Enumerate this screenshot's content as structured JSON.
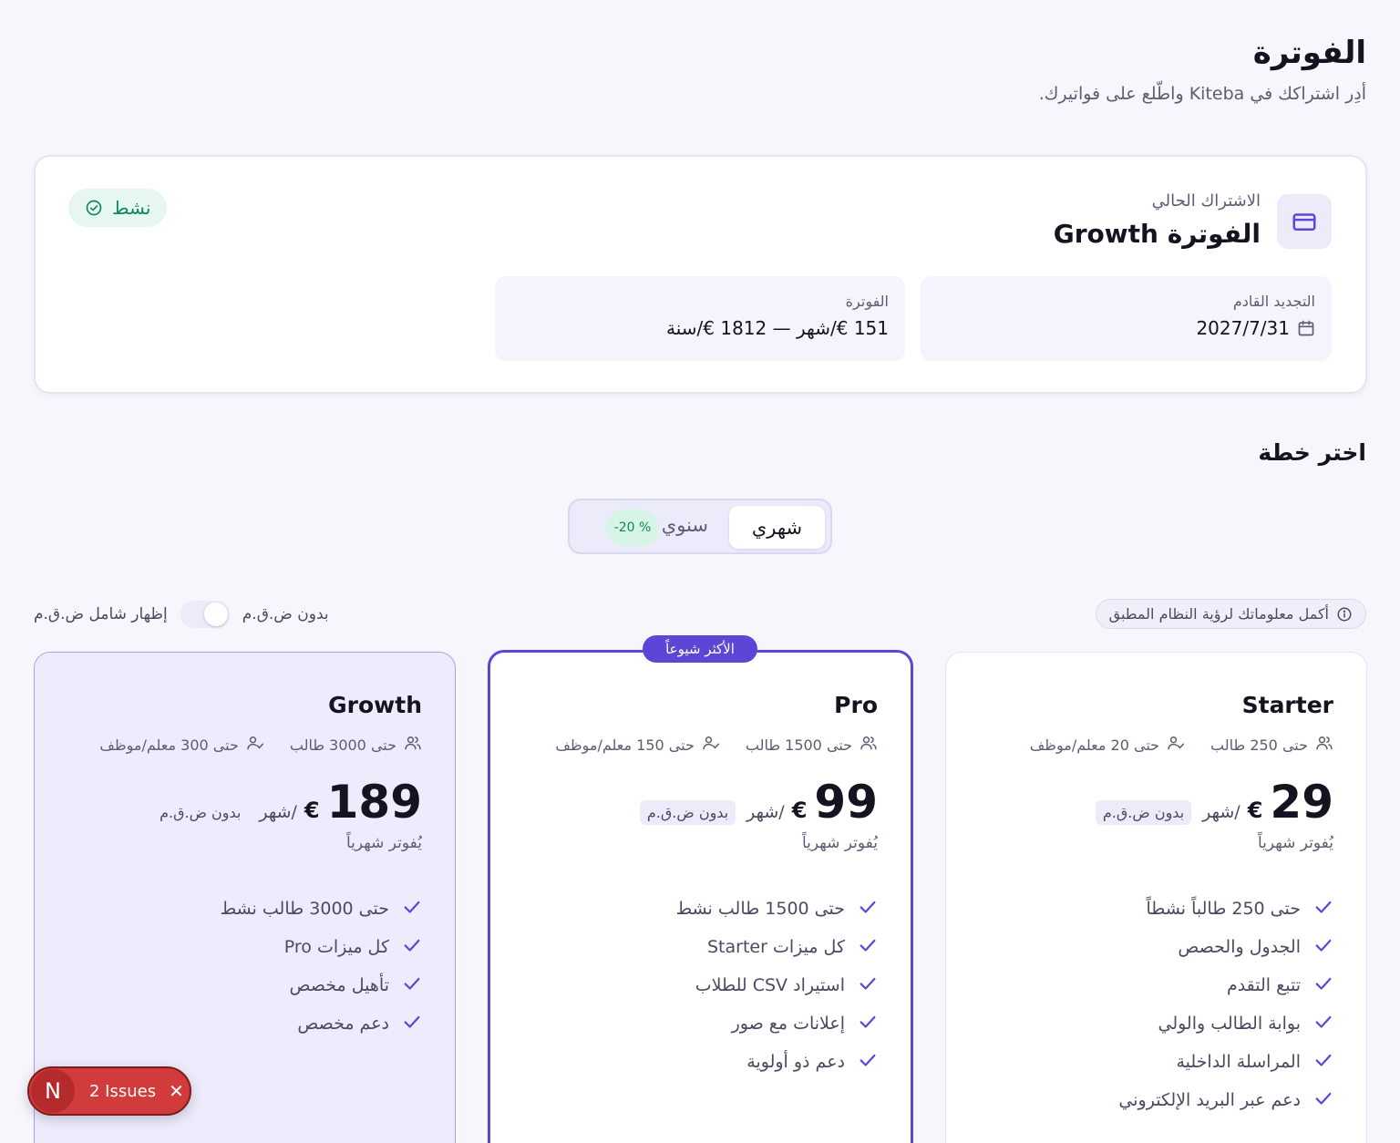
{
  "header": {
    "title": "الفوترة",
    "subtitle": "أدِر اشتراكك في Kiteba واطّلع على فواتيرك."
  },
  "subscription": {
    "caption": "الاشتراك الحالي",
    "plan_name": "الفوترة Growth",
    "status": "نشط",
    "next_renewal_label": "التجديد القادم",
    "next_renewal_value": "2027/7/31",
    "billing_label": "الفوترة",
    "billing_value": "151 €/شهر — 1812 €/سنة"
  },
  "choose_plan": {
    "title": "اختر خطة",
    "monthly_label": "شهري",
    "yearly_label": "سنوي",
    "yearly_discount": "-20 %",
    "info_text": "أكمل معلوماتك لرؤية النظام المطبق",
    "vat_off_label": "بدون ض.ق.م",
    "vat_on_label": "إظهار شامل ض.ق.م",
    "vat_toggle_on": false,
    "popular_badge": "الأكثر شيوعاً"
  },
  "plans": [
    {
      "name": "Starter",
      "students": "حتى 250 طالب",
      "staff": "حتى 20 معلم/موظف",
      "price": "29",
      "currency": "€",
      "per": "/شهر",
      "vat": "بدون ض.ق.م",
      "billing": "يُفوتر شهرياً",
      "features": [
        "حتى 250 طالباً نشطاً",
        "الجدول والحصص",
        "تتبع التقدم",
        "بوابة الطالب والولي",
        "المراسلة الداخلية",
        "دعم عبر البريد الإلكتروني"
      ]
    },
    {
      "name": "Pro",
      "students": "حتى 1500 طالب",
      "staff": "حتى 150 معلم/موظف",
      "price": "99",
      "currency": "€",
      "per": "/شهر",
      "vat": "بدون ض.ق.م",
      "billing": "يُفوتر شهرياً",
      "features": [
        "حتى 1500 طالب نشط",
        "كل ميزات Starter",
        "استيراد CSV للطلاب",
        "إعلانات مع صور",
        "دعم ذو أولوية"
      ]
    },
    {
      "name": "Growth",
      "students": "حتى 3000 طالب",
      "staff": "حتى 300 معلم/موظف",
      "price": "189",
      "currency": "€",
      "per": "/شهر",
      "vat": "بدون ض.ق.م",
      "billing": "يُفوتر شهرياً",
      "features": [
        "حتى 3000 طالب نشط",
        "كل ميزات Pro",
        "تأهيل مخصص",
        "دعم مخصص"
      ]
    }
  ],
  "dev_overlay": {
    "logo": "N",
    "issues": "2 Issues"
  },
  "colors": {
    "accent": "#5b46d6",
    "success": "#11865a",
    "danger": "#d23b3b"
  }
}
